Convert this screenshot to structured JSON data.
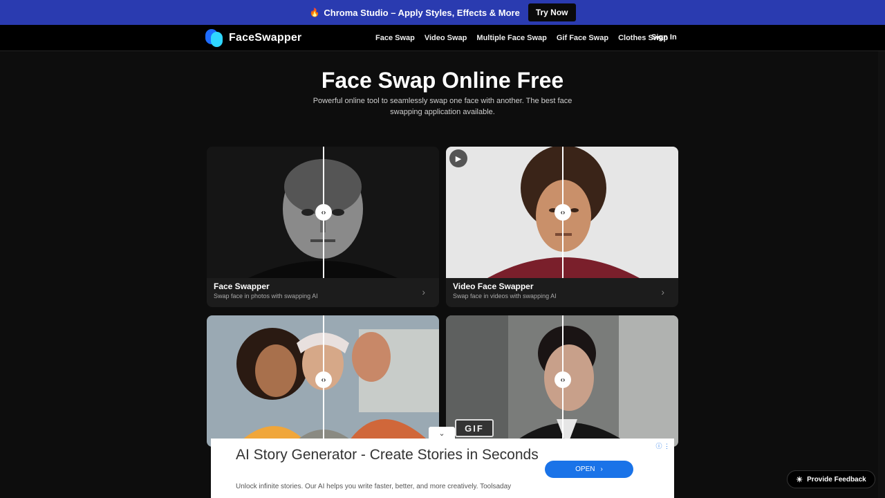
{
  "promo": {
    "fire_icon": "fire-icon",
    "text": "Chroma Studio – Apply Styles, Effects & More",
    "button": "Try Now"
  },
  "nav": {
    "logo_text": "FaceSwapper",
    "links": [
      "Face Swap",
      "Video Swap",
      "Multiple Face Swap",
      "Gif Face Swap",
      "Clothes Swap"
    ],
    "sign_in": "Sign In"
  },
  "hero": {
    "title": "Face Swap Online Free",
    "subtitle": "Powerful online tool to seamlessly swap one face with another. The best face swapping application available."
  },
  "cards": [
    {
      "title": "Face Swapper",
      "subtitle": "Swap face in photos with swapping AI"
    },
    {
      "title": "Video Face Swapper",
      "subtitle": "Swap face in videos with swapping AI"
    },
    {
      "title": "",
      "subtitle": ""
    },
    {
      "title": "",
      "subtitle": "",
      "badge": "GIF"
    }
  ],
  "ad": {
    "headline": "AI Story Generator - Create Stories in Seconds",
    "description": "Unlock infinite stories. Our AI helps you write faster, better, and more creatively. Toolsaday",
    "button": "OPEN"
  },
  "feedback": {
    "label": "Provide  Feedback"
  },
  "colors": {
    "promo_bg": "#2a3bb0",
    "page_bg": "#0d0d0d",
    "accent": "#1a73e8"
  }
}
